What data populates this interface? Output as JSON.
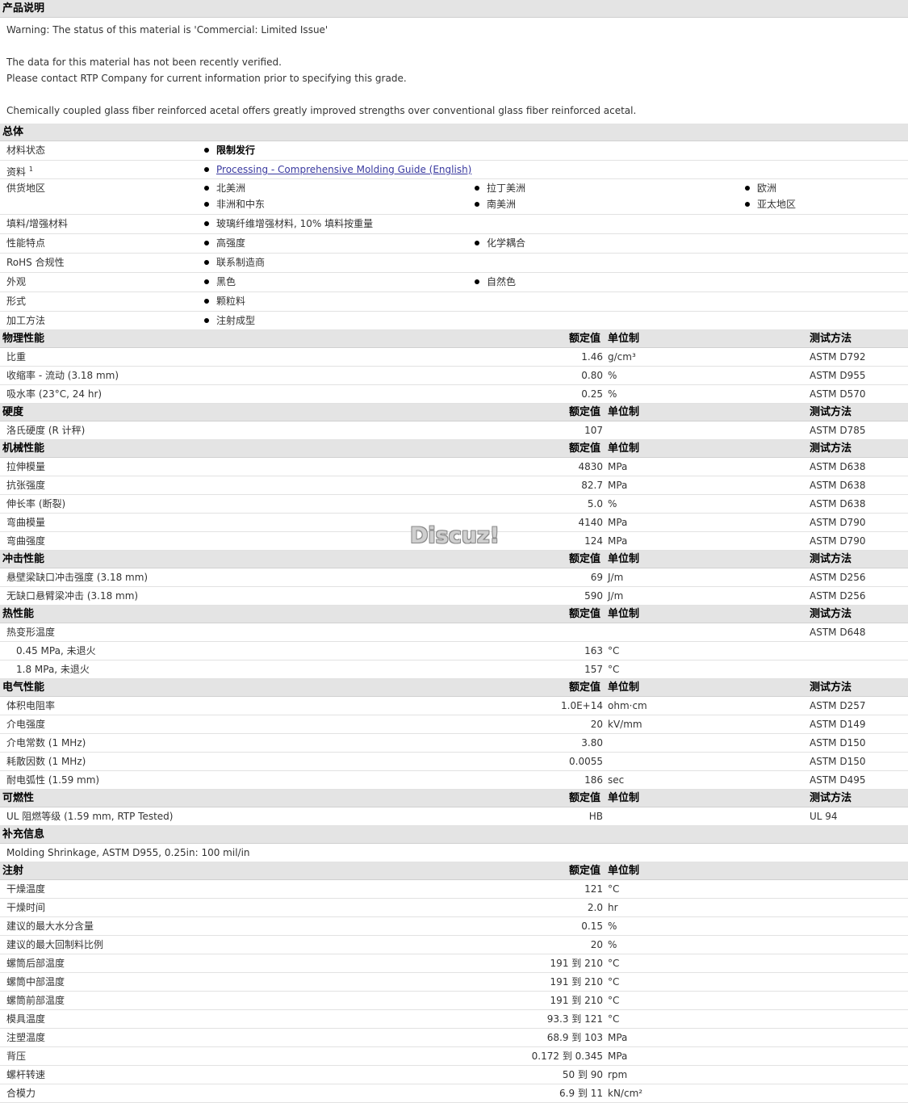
{
  "description": {
    "title": "产品说明",
    "lines": [
      "Warning: The status of this material is 'Commercial: Limited Issue'",
      "",
      "The data for this material has not been recently verified.",
      "Please contact RTP Company for current information prior to specifying this grade.",
      "",
      "Chemically coupled glass fiber reinforced acetal offers greatly improved strengths over conventional glass fiber reinforced acetal."
    ]
  },
  "general": {
    "title": "总体",
    "rows": [
      {
        "label": "材料状态",
        "items": [
          "限制发行"
        ],
        "style": "bold",
        "height": 23
      },
      {
        "label": "资料",
        "sup": "1",
        "items": [
          "Processing - Comprehensive Molding Guide (English)"
        ],
        "style": "link",
        "height": 22
      },
      {
        "label": "供货地区",
        "items": [
          "北美洲",
          "拉丁美洲",
          "欧洲",
          "非洲和中东",
          "南美洲",
          "亚太地区"
        ],
        "cols": 3,
        "height": 43
      },
      {
        "label": "填料/增强材料",
        "items": [
          "玻璃纤维增强材料, 10% 填料按重量"
        ],
        "height": 23
      },
      {
        "label": "性能特点",
        "items": [
          "高强度",
          "化学耦合"
        ],
        "cols": 3,
        "height": 23
      },
      {
        "label": "RoHS 合规性",
        "items": [
          "联系制造商"
        ],
        "height": 23
      },
      {
        "label": "外观",
        "items": [
          "黑色",
          "自然色"
        ],
        "cols": 3,
        "height": 23
      },
      {
        "label": "形式",
        "items": [
          "颗粒料"
        ],
        "height": 23
      },
      {
        "label": "加工方法",
        "items": [
          "注射成型"
        ],
        "height": 22
      }
    ]
  },
  "headers": {
    "nominal": "额定值",
    "unit": "单位制",
    "method": "测试方法"
  },
  "sections": [
    {
      "title": "物理性能",
      "showMethod": true,
      "rows": [
        {
          "label": "比重",
          "value": "1.46",
          "unit": "g/cm³",
          "method": "ASTM D792"
        },
        {
          "label": "收缩率  - 流动  (3.18 mm)",
          "value": "0.80",
          "unit": "%",
          "method": "ASTM D955"
        },
        {
          "label": "吸水率  (23°C, 24 hr)",
          "value": "0.25",
          "unit": "%",
          "method": "ASTM D570"
        }
      ]
    },
    {
      "title": "硬度",
      "showMethod": true,
      "rows": [
        {
          "label": "洛氏硬度  (R 计秤)",
          "value": "107",
          "unit": "",
          "method": "ASTM D785"
        }
      ]
    },
    {
      "title": "机械性能",
      "showMethod": true,
      "rows": [
        {
          "label": "拉伸模量",
          "value": "4830",
          "unit": "MPa",
          "method": "ASTM D638"
        },
        {
          "label": "抗张强度",
          "value": "82.7",
          "unit": "MPa",
          "method": "ASTM D638"
        },
        {
          "label": "伸长率  (断裂)",
          "value": "5.0",
          "unit": "%",
          "method": "ASTM D638"
        },
        {
          "label": "弯曲模量",
          "value": "4140",
          "unit": "MPa",
          "method": "ASTM D790"
        },
        {
          "label": "弯曲强度",
          "value": "124",
          "unit": "MPa",
          "method": "ASTM D790"
        }
      ]
    },
    {
      "title": "冲击性能",
      "showMethod": true,
      "rows": [
        {
          "label": "悬壁梁缺口冲击强度  (3.18 mm)",
          "value": "69",
          "unit": "J/m",
          "method": "ASTM D256"
        },
        {
          "label": "无缺口悬臂梁冲击  (3.18 mm)",
          "value": "590",
          "unit": "J/m",
          "method": "ASTM D256"
        }
      ]
    },
    {
      "title": "热性能",
      "showMethod": true,
      "rows": [
        {
          "label": "热变形温度",
          "value": "",
          "unit": "",
          "method": "ASTM D648"
        },
        {
          "label": "0.45 MPa, 未退火",
          "value": "163",
          "unit": "°C",
          "method": "",
          "indent": true
        },
        {
          "label": "1.8 MPa, 未退火",
          "value": "157",
          "unit": "°C",
          "method": "",
          "indent": true
        }
      ]
    },
    {
      "title": "电气性能",
      "showMethod": true,
      "rows": [
        {
          "label": "体积电阻率",
          "value": "1.0E+14",
          "unit": "ohm·cm",
          "method": "ASTM D257"
        },
        {
          "label": "介电强度",
          "value": "20",
          "unit": "kV/mm",
          "method": "ASTM D149"
        },
        {
          "label": "介电常数  (1 MHz)",
          "value": "3.80",
          "unit": "",
          "method": "ASTM D150"
        },
        {
          "label": "耗散因数  (1 MHz)",
          "value": "0.0055",
          "unit": "",
          "method": "ASTM D150"
        },
        {
          "label": "耐电弧性  (1.59 mm)",
          "value": "186",
          "unit": "sec",
          "method": "ASTM D495"
        }
      ]
    },
    {
      "title": "可燃性",
      "showMethod": true,
      "rows": [
        {
          "label": "UL 阻燃等级  (1.59 mm, RTP Tested)",
          "value": "HB",
          "unit": "",
          "method": "UL 94"
        }
      ]
    }
  ],
  "supplement": {
    "title": "补充信息",
    "text": "Molding Shrinkage, ASTM D955, 0.25in: 100 mil/in"
  },
  "injection": {
    "title": "注射",
    "showMethod": false,
    "rows": [
      {
        "label": "干燥温度",
        "value": "121",
        "unit": "°C"
      },
      {
        "label": "干燥时间",
        "value": "2.0",
        "unit": "hr"
      },
      {
        "label": "建议的最大水分含量",
        "value": "0.15",
        "unit": "%"
      },
      {
        "label": "建议的最大回制料比例",
        "value": "20",
        "unit": "%"
      },
      {
        "label": "螺筒后部温度",
        "value": "191 到  210",
        "unit": "°C"
      },
      {
        "label": "螺筒中部温度",
        "value": "191 到  210",
        "unit": "°C"
      },
      {
        "label": "螺筒前部温度",
        "value": "191 到  210",
        "unit": "°C"
      },
      {
        "label": "模具温度",
        "value": "93.3 到  121",
        "unit": "°C"
      },
      {
        "label": "注塑温度",
        "value": "68.9 到  103",
        "unit": "MPa"
      },
      {
        "label": "背压",
        "value": "0.172 到  0.345",
        "unit": "MPa"
      },
      {
        "label": "螺杆转速",
        "value": "50 到  90",
        "unit": "rpm"
      },
      {
        "label": "合模力",
        "value": "6.9 到  11",
        "unit": "kN/cm²"
      }
    ]
  },
  "watermark": "Discuz!"
}
